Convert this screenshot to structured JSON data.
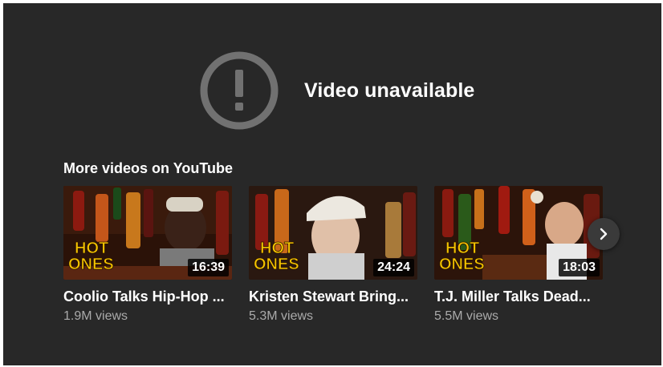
{
  "error": {
    "icon": "alert-circle-icon",
    "title": "Video unavailable"
  },
  "more": {
    "heading": "More videos on YouTube"
  },
  "videos": [
    {
      "title": "Coolio Talks Hip-Hop ...",
      "views": "1.9M views",
      "duration": "16:39",
      "logo_line1": "HOT",
      "logo_line2": "ONES"
    },
    {
      "title": "Kristen Stewart Bring...",
      "views": "5.3M views",
      "duration": "24:24",
      "logo_line1": "HOT",
      "logo_line2": "ONES"
    },
    {
      "title": "T.J. Miller Talks Dead...",
      "views": "5.5M views",
      "duration": "18:03",
      "logo_line1": "HOT",
      "logo_line2": "ONES"
    }
  ],
  "carousel": {
    "next_icon": "chevron-right-icon"
  },
  "colors": {
    "background": "#282828",
    "text": "#ffffff",
    "muted": "#aaaaaa",
    "icon": "#717171",
    "logo": "#f5c400"
  }
}
